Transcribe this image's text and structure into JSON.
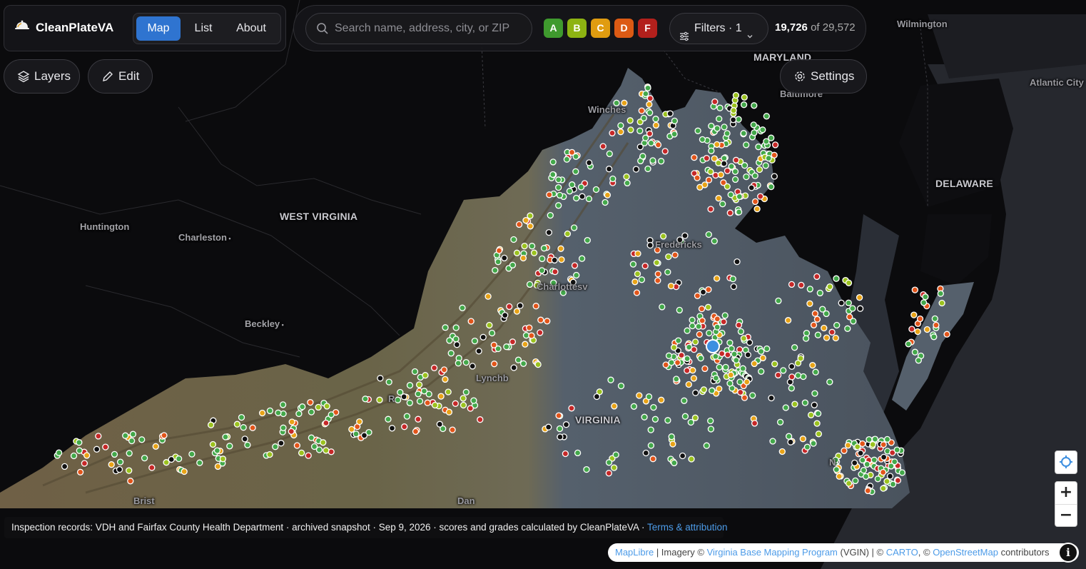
{
  "app": {
    "name": "CleanPlateVA",
    "logo_icon": "cloche-icon"
  },
  "nav": {
    "tabs": [
      {
        "label": "Map",
        "active": true
      },
      {
        "label": "List",
        "active": false
      },
      {
        "label": "About",
        "active": false
      }
    ]
  },
  "search": {
    "placeholder": "Search name, address, city, or ZIP"
  },
  "grades": [
    {
      "label": "A",
      "color": "#3f9a2e"
    },
    {
      "label": "B",
      "color": "#8db312"
    },
    {
      "label": "C",
      "color": "#e09c10"
    },
    {
      "label": "D",
      "color": "#dc5a14"
    },
    {
      "label": "F",
      "color": "#b3201c"
    }
  ],
  "filters": {
    "label": "Filters · 1"
  },
  "results": {
    "shown": "19,726",
    "total_text": "of 29,572"
  },
  "toolbar": {
    "layers_label": "Layers",
    "edit_label": "Edit",
    "settings_label": "Settings"
  },
  "map_labels": {
    "wilmington": "Wilmington",
    "maryland": "MARYLAND",
    "baltimore": "Baltimore",
    "atlantic_city": "Atlantic City",
    "delaware": "DELAWARE",
    "west_virginia": "WEST VIRGINIA",
    "huntington": "Huntington",
    "charleston": "Charleston",
    "beckley": "Beckley",
    "winchester": "Winches",
    "fredericksburg": "Fredericks",
    "charlottesville": "Charlottesv",
    "lynchburg": "Lynchb",
    "roanoke": "R",
    "virginia": "VIRGINIA",
    "bristol": "Brist",
    "danville": "Dan",
    "norfolk": "N"
  },
  "attribution": {
    "text": "Inspection records: VDH and Fairfax County Health Department · archived snapshot · Sep 9, 2026 · scores and grades calculated by CleanPlateVA · ",
    "link": "Terms & attribution"
  },
  "credits": {
    "maplibre": "MapLibre",
    "sep1": " | Imagery © ",
    "vgin": "Virginia Base Mapping Program",
    "vgin_abbr": " (VGIN) | © ",
    "carto": "CARTO",
    "sep2": ", © ",
    "osm": "OpenStreetMap",
    "contributors": " contributors"
  },
  "controls": {
    "locate_icon": "locate-icon",
    "zoom_in": "+",
    "zoom_out": "−",
    "info": "i"
  },
  "marker_colors": {
    "A": "#43a84a",
    "B": "#9bc21e",
    "C": "#e8a317",
    "D": "#e2551a",
    "F": "#c62828",
    "unknown": "#111111",
    "selected": "#3d8fe0"
  }
}
